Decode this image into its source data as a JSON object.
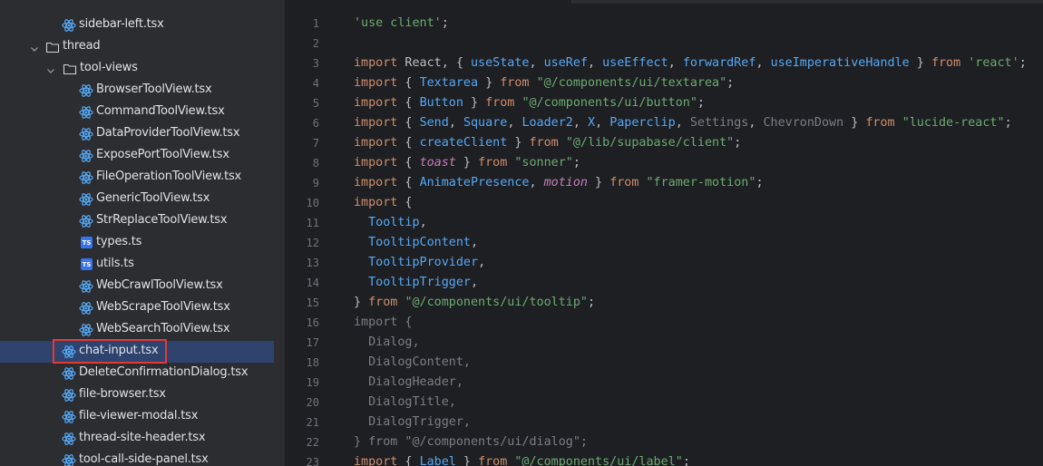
{
  "colors": {
    "sidebar_bg": "#2b2d30",
    "editor_bg": "#1e1f22",
    "selection": "#2e436e",
    "highlight_border": "#e53935",
    "keyword": "#cf8e6d",
    "string": "#6aab73",
    "identifier": "#56a8f5",
    "text": "#bcbec4",
    "unused": "#7a7e85",
    "italic_import": "#c77dbb",
    "react_icon": "#56a8f5",
    "ts_badge": "#3574f0"
  },
  "sidebar": {
    "items": [
      {
        "label": "sidebar-left.tsx",
        "icon": "react-icon"
      },
      {
        "label": "thread",
        "icon": "folder-icon"
      },
      {
        "label": "tool-views",
        "icon": "folder-icon"
      },
      {
        "label": "BrowserToolView.tsx",
        "icon": "react-icon"
      },
      {
        "label": "CommandToolView.tsx",
        "icon": "react-icon"
      },
      {
        "label": "DataProviderToolView.tsx",
        "icon": "react-icon"
      },
      {
        "label": "ExposePortToolView.tsx",
        "icon": "react-icon"
      },
      {
        "label": "FileOperationToolView.tsx",
        "icon": "react-icon"
      },
      {
        "label": "GenericToolView.tsx",
        "icon": "react-icon"
      },
      {
        "label": "StrReplaceToolView.tsx",
        "icon": "react-icon"
      },
      {
        "label": "types.ts",
        "icon": "typescript-icon",
        "badge": "TS"
      },
      {
        "label": "utils.ts",
        "icon": "typescript-icon",
        "badge": "TS"
      },
      {
        "label": "WebCrawlToolView.tsx",
        "icon": "react-icon"
      },
      {
        "label": "WebScrapeToolView.tsx",
        "icon": "react-icon"
      },
      {
        "label": "WebSearchToolView.tsx",
        "icon": "react-icon"
      },
      {
        "label": "chat-input.tsx",
        "icon": "react-icon",
        "selected": true
      },
      {
        "label": "DeleteConfirmationDialog.tsx",
        "icon": "react-icon"
      },
      {
        "label": "file-browser.tsx",
        "icon": "react-icon"
      },
      {
        "label": "file-viewer-modal.tsx",
        "icon": "react-icon"
      },
      {
        "label": "thread-site-header.tsx",
        "icon": "react-icon"
      },
      {
        "label": "tool-call-side-panel.tsx",
        "icon": "react-icon"
      }
    ]
  },
  "editor": {
    "lines": [
      {
        "n": "1",
        "tokens": [
          {
            "c": "s",
            "t": "'use client'"
          },
          {
            "c": "t",
            "t": ";"
          }
        ]
      },
      {
        "n": "2",
        "tokens": []
      },
      {
        "n": "3",
        "tokens": [
          {
            "c": "k",
            "t": "import"
          },
          {
            "c": "t",
            "t": " React, { "
          },
          {
            "c": "f",
            "t": "useState"
          },
          {
            "c": "t",
            "t": ", "
          },
          {
            "c": "f",
            "t": "useRef"
          },
          {
            "c": "t",
            "t": ", "
          },
          {
            "c": "f",
            "t": "useEffect"
          },
          {
            "c": "t",
            "t": ", "
          },
          {
            "c": "f",
            "t": "forwardRef"
          },
          {
            "c": "t",
            "t": ", "
          },
          {
            "c": "f",
            "t": "useImperativeHandle"
          },
          {
            "c": "t",
            "t": " } "
          },
          {
            "c": "k",
            "t": "from"
          },
          {
            "c": "t",
            "t": " "
          },
          {
            "c": "s",
            "t": "'react'"
          },
          {
            "c": "t",
            "t": ";"
          }
        ]
      },
      {
        "n": "4",
        "tokens": [
          {
            "c": "k",
            "t": "import"
          },
          {
            "c": "t",
            "t": " { "
          },
          {
            "c": "f",
            "t": "Textarea"
          },
          {
            "c": "t",
            "t": " } "
          },
          {
            "c": "k",
            "t": "from"
          },
          {
            "c": "t",
            "t": " "
          },
          {
            "c": "s",
            "t": "\"@/components/ui/textarea\""
          },
          {
            "c": "t",
            "t": ";"
          }
        ]
      },
      {
        "n": "5",
        "tokens": [
          {
            "c": "k",
            "t": "import"
          },
          {
            "c": "t",
            "t": " { "
          },
          {
            "c": "f",
            "t": "Button"
          },
          {
            "c": "t",
            "t": " } "
          },
          {
            "c": "k",
            "t": "from"
          },
          {
            "c": "t",
            "t": " "
          },
          {
            "c": "s",
            "t": "\"@/components/ui/button\""
          },
          {
            "c": "t",
            "t": ";"
          }
        ]
      },
      {
        "n": "6",
        "tokens": [
          {
            "c": "k",
            "t": "import"
          },
          {
            "c": "t",
            "t": " { "
          },
          {
            "c": "f",
            "t": "Send"
          },
          {
            "c": "t",
            "t": ", "
          },
          {
            "c": "f",
            "t": "Square"
          },
          {
            "c": "t",
            "t": ", "
          },
          {
            "c": "f",
            "t": "Loader2"
          },
          {
            "c": "t",
            "t": ", "
          },
          {
            "c": "f",
            "t": "X"
          },
          {
            "c": "t",
            "t": ", "
          },
          {
            "c": "f",
            "t": "Paperclip"
          },
          {
            "c": "t",
            "t": ", "
          },
          {
            "c": "g",
            "t": "Settings"
          },
          {
            "c": "t",
            "t": ", "
          },
          {
            "c": "g",
            "t": "ChevronDown"
          },
          {
            "c": "t",
            "t": " } "
          },
          {
            "c": "k",
            "t": "from"
          },
          {
            "c": "t",
            "t": " "
          },
          {
            "c": "s",
            "t": "\"lucide-react\""
          },
          {
            "c": "t",
            "t": ";"
          }
        ]
      },
      {
        "n": "7",
        "tokens": [
          {
            "c": "k",
            "t": "import"
          },
          {
            "c": "t",
            "t": " { "
          },
          {
            "c": "f",
            "t": "createClient"
          },
          {
            "c": "t",
            "t": " } "
          },
          {
            "c": "k",
            "t": "from"
          },
          {
            "c": "t",
            "t": " "
          },
          {
            "c": "s",
            "t": "\"@/lib/supabase/client\""
          },
          {
            "c": "t",
            "t": ";"
          }
        ]
      },
      {
        "n": "8",
        "tokens": [
          {
            "c": "k",
            "t": "import"
          },
          {
            "c": "t",
            "t": " { "
          },
          {
            "c": "i",
            "t": "toast"
          },
          {
            "c": "t",
            "t": " } "
          },
          {
            "c": "k",
            "t": "from"
          },
          {
            "c": "t",
            "t": " "
          },
          {
            "c": "s",
            "t": "\"sonner\""
          },
          {
            "c": "t",
            "t": ";"
          }
        ]
      },
      {
        "n": "9",
        "tokens": [
          {
            "c": "k",
            "t": "import"
          },
          {
            "c": "t",
            "t": " { "
          },
          {
            "c": "f",
            "t": "AnimatePresence"
          },
          {
            "c": "t",
            "t": ", "
          },
          {
            "c": "i",
            "t": "motion"
          },
          {
            "c": "t",
            "t": " } "
          },
          {
            "c": "k",
            "t": "from"
          },
          {
            "c": "t",
            "t": " "
          },
          {
            "c": "s",
            "t": "\"framer-motion\""
          },
          {
            "c": "t",
            "t": ";"
          }
        ]
      },
      {
        "n": "10",
        "tokens": [
          {
            "c": "k",
            "t": "import"
          },
          {
            "c": "t",
            "t": " {"
          }
        ]
      },
      {
        "n": "11",
        "tokens": [
          {
            "c": "t",
            "t": "  "
          },
          {
            "c": "f",
            "t": "Tooltip"
          },
          {
            "c": "t",
            "t": ","
          }
        ]
      },
      {
        "n": "12",
        "tokens": [
          {
            "c": "t",
            "t": "  "
          },
          {
            "c": "f",
            "t": "TooltipContent"
          },
          {
            "c": "t",
            "t": ","
          }
        ]
      },
      {
        "n": "13",
        "tokens": [
          {
            "c": "t",
            "t": "  "
          },
          {
            "c": "f",
            "t": "TooltipProvider"
          },
          {
            "c": "t",
            "t": ","
          }
        ]
      },
      {
        "n": "14",
        "tokens": [
          {
            "c": "t",
            "t": "  "
          },
          {
            "c": "f",
            "t": "TooltipTrigger"
          },
          {
            "c": "t",
            "t": ","
          }
        ]
      },
      {
        "n": "15",
        "tokens": [
          {
            "c": "t",
            "t": "} "
          },
          {
            "c": "k",
            "t": "from"
          },
          {
            "c": "t",
            "t": " "
          },
          {
            "c": "s",
            "t": "\"@/components/ui/tooltip\""
          },
          {
            "c": "t",
            "t": ";"
          }
        ]
      },
      {
        "n": "16",
        "tokens": [
          {
            "c": "g",
            "t": "import {"
          }
        ]
      },
      {
        "n": "17",
        "tokens": [
          {
            "c": "g",
            "t": "  Dialog,"
          }
        ]
      },
      {
        "n": "18",
        "tokens": [
          {
            "c": "g",
            "t": "  DialogContent,"
          }
        ]
      },
      {
        "n": "19",
        "tokens": [
          {
            "c": "g",
            "t": "  DialogHeader,"
          }
        ]
      },
      {
        "n": "20",
        "tokens": [
          {
            "c": "g",
            "t": "  DialogTitle,"
          }
        ]
      },
      {
        "n": "21",
        "tokens": [
          {
            "c": "g",
            "t": "  DialogTrigger,"
          }
        ]
      },
      {
        "n": "22",
        "tokens": [
          {
            "c": "g",
            "t": "} from \"@/components/ui/dialog\";"
          }
        ]
      },
      {
        "n": "23",
        "tokens": [
          {
            "c": "k",
            "t": "import"
          },
          {
            "c": "t",
            "t": " { "
          },
          {
            "c": "f",
            "t": "Label"
          },
          {
            "c": "t",
            "t": " } "
          },
          {
            "c": "k",
            "t": "from"
          },
          {
            "c": "t",
            "t": " "
          },
          {
            "c": "s",
            "t": "\"@/components/ui/label\""
          },
          {
            "c": "t",
            "t": ";"
          }
        ]
      }
    ]
  }
}
